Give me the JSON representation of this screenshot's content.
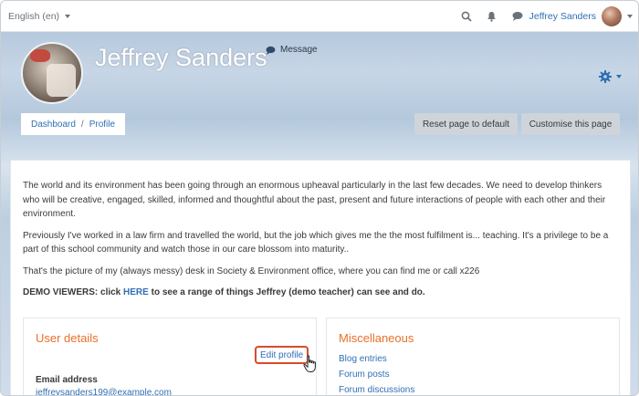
{
  "navbar": {
    "language": "English (en)",
    "user_name": "Jeffrey Sanders",
    "icons": [
      "search-icon",
      "bell-icon",
      "chat-icon"
    ]
  },
  "header": {
    "name": "Jeffrey Sanders",
    "message_label": "Message",
    "breadcrumb": [
      "Dashboard",
      "Profile"
    ],
    "breadcrumb_separator": "/",
    "reset_label": "Reset page to default",
    "customise_label": "Customise this page"
  },
  "bio": {
    "p1": "The world and its environment has been going through an enormous upheaval particularly in the last few decades. We need to develop thinkers who will be creative, engaged, skilled, informed and thoughtful about the past, present and future interactions of people with each other and their environment.",
    "p2": "Previously I've worked in a law firm and travelled the world,  but the job which gives me the the most fulfilment is... teaching. It's a privilege to be a part of this school community and watch those in our care blossom into maturity..",
    "p3": "That's the picture of my (always messy) desk in Society & Environment office, where you can find me or call x226",
    "demo_prefix": "DEMO VIEWERS: click",
    "demo_link": "HERE",
    "demo_suffix": "to see a range of things Jeffrey (demo teacher) can see and do."
  },
  "user_details": {
    "title": "User details",
    "edit_label": "Edit profile",
    "email_label": "Email address",
    "email_value": "jeffreysanders199@example.com"
  },
  "miscellaneous": {
    "title": "Miscellaneous",
    "links": [
      "Blog entries",
      "Forum posts",
      "Forum discussions"
    ]
  },
  "colors": {
    "accent": "#e8702a",
    "link": "#2f6fb4",
    "highlight_border": "#d84b2a"
  }
}
